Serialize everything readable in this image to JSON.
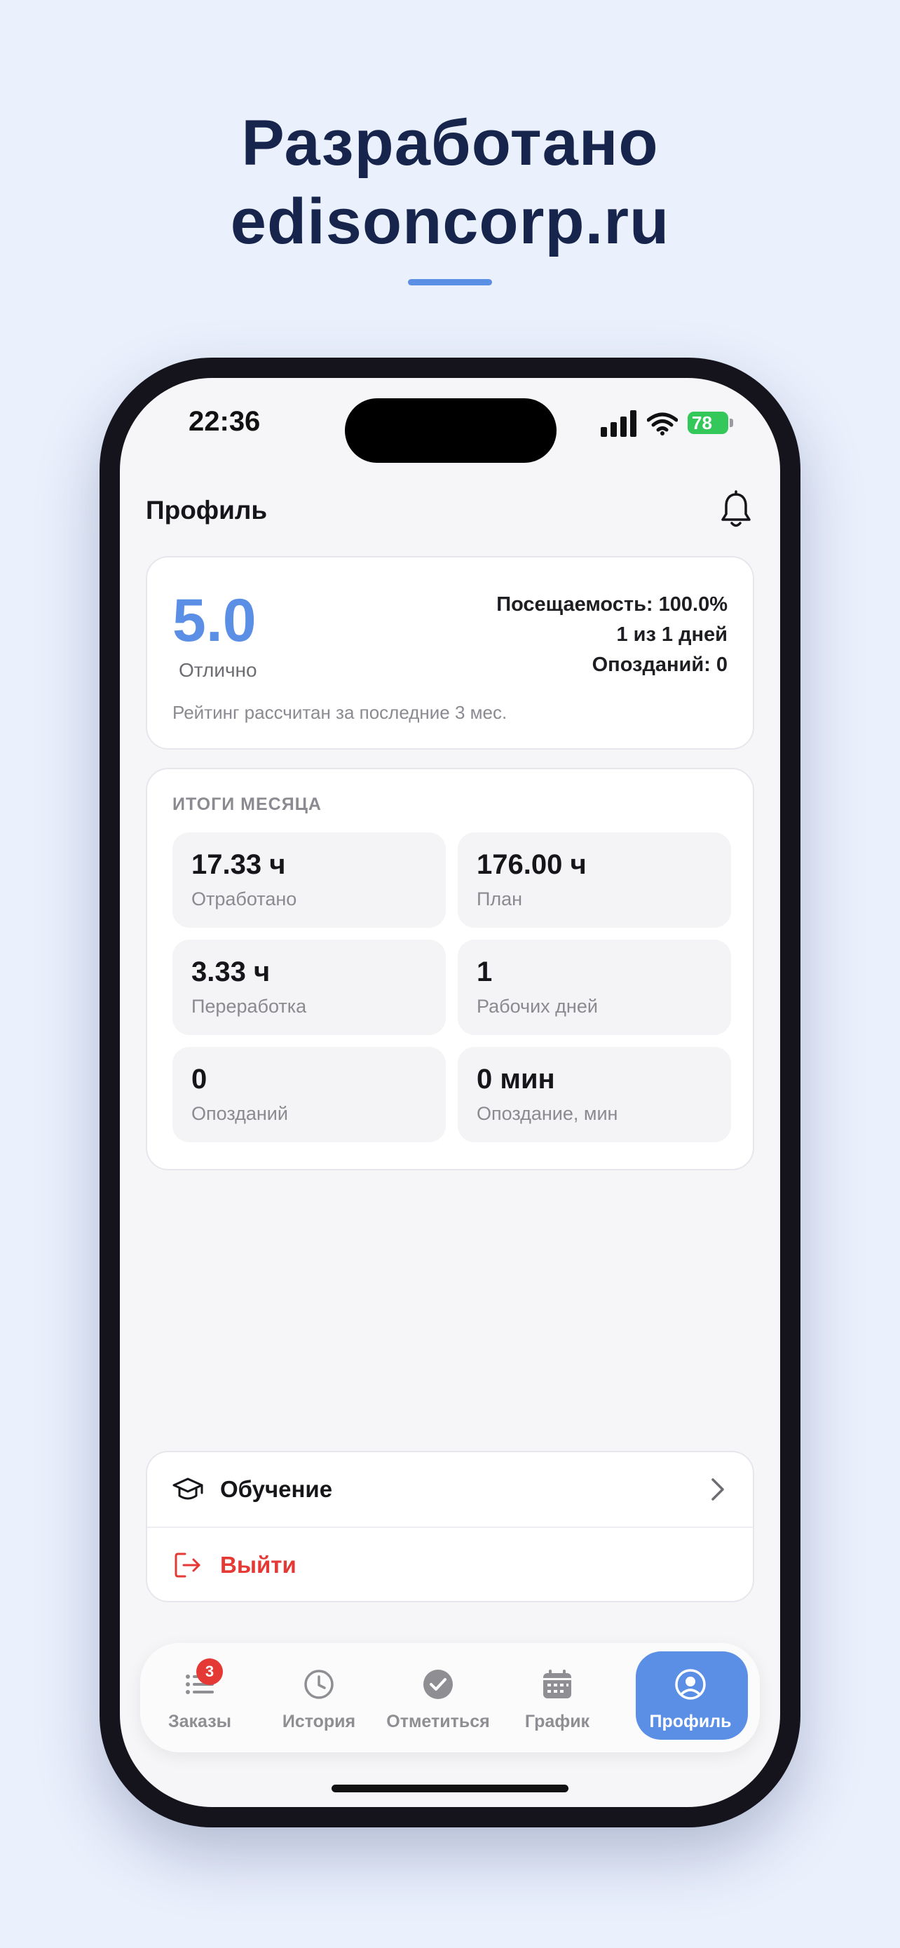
{
  "promo": {
    "line1": "Разработано",
    "line2": "edisoncorp.ru"
  },
  "status_bar": {
    "time": "22:36",
    "battery": "78"
  },
  "header": {
    "title": "Профиль",
    "bell_icon": "bell-icon"
  },
  "rating": {
    "value": "5.0",
    "word": "Отлично",
    "attendance": "Посещаемость: 100.0%",
    "days": "1 из 1 дней",
    "late": "Опозданий: 0",
    "note": "Рейтинг рассчитан за последние 3 мес."
  },
  "month": {
    "title": "ИТОГИ МЕСЯЦА",
    "tiles": [
      {
        "value": "17.33 ч",
        "label": "Отработано"
      },
      {
        "value": "176.00 ч",
        "label": "План"
      },
      {
        "value": "3.33 ч",
        "label": "Переработка"
      },
      {
        "value": "1",
        "label": "Рабочих дней"
      },
      {
        "value": "0",
        "label": "Опозданий"
      },
      {
        "value": "0 мин",
        "label": "Опоздание, мин"
      }
    ]
  },
  "menu": {
    "learning": {
      "label": "Обучение",
      "icon": "graduation-cap-icon"
    },
    "logout": {
      "label": "Выйти",
      "icon": "logout-icon",
      "color": "#e53935"
    }
  },
  "tabbar": {
    "items": [
      {
        "label": "Заказы",
        "icon": "list-icon",
        "badge": "3"
      },
      {
        "label": "История",
        "icon": "clock-icon"
      },
      {
        "label": "Отметиться",
        "icon": "check-circle-icon"
      },
      {
        "label": "График",
        "icon": "calendar-icon"
      },
      {
        "label": "Профиль",
        "icon": "user-circle-icon",
        "active": true
      }
    ]
  },
  "colors": {
    "accent": "#5b8fe6",
    "danger": "#e53935",
    "title": "#17254d"
  }
}
